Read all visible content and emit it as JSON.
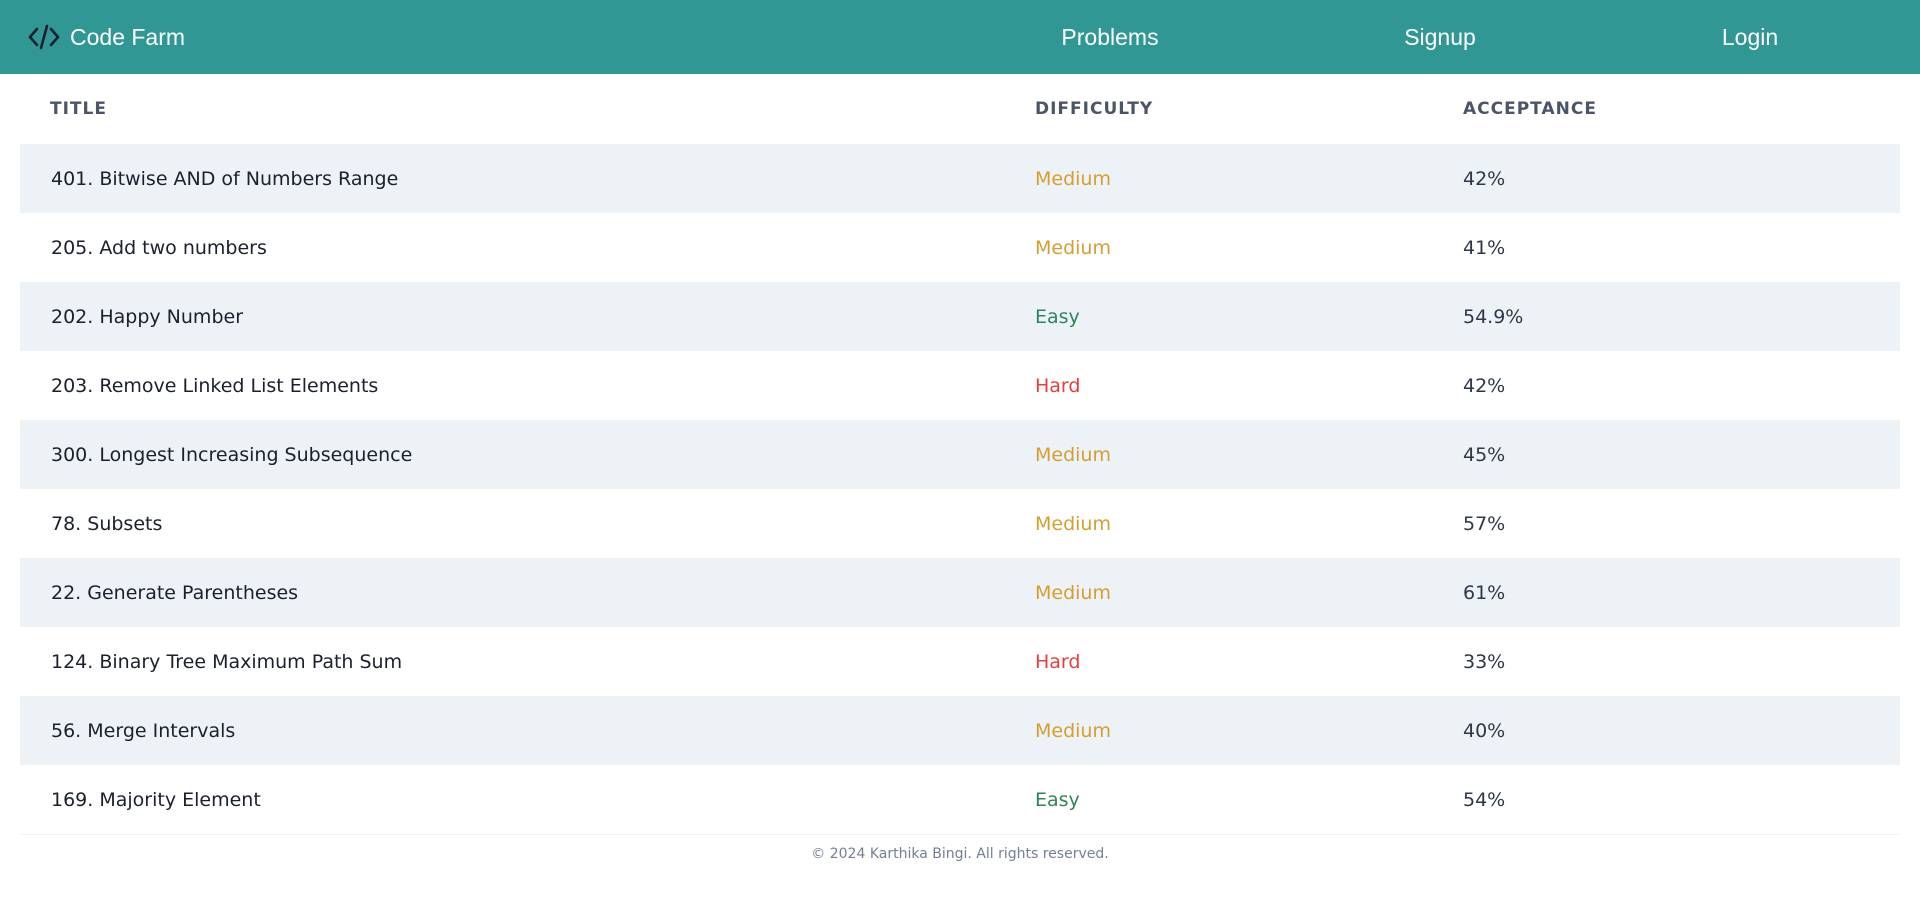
{
  "navbar": {
    "brand_icon": "code-icon",
    "brand_name": "Code Farm",
    "links": [
      "Problems",
      "Signup",
      "Login"
    ]
  },
  "table": {
    "headers": {
      "title": "Title",
      "difficulty": "Difficulty",
      "acceptance": "Acceptance"
    },
    "rows": [
      {
        "title": "401. Bitwise AND of Numbers Range",
        "difficulty": "Medium",
        "acceptance": "42%"
      },
      {
        "title": "205. Add two numbers",
        "difficulty": "Medium",
        "acceptance": "41%"
      },
      {
        "title": "202. Happy Number",
        "difficulty": "Easy",
        "acceptance": "54.9%"
      },
      {
        "title": "203. Remove Linked List Elements",
        "difficulty": "Hard",
        "acceptance": "42%"
      },
      {
        "title": "300. Longest Increasing Subsequence",
        "difficulty": "Medium",
        "acceptance": "45%"
      },
      {
        "title": "78. Subsets",
        "difficulty": "Medium",
        "acceptance": "57%"
      },
      {
        "title": "22. Generate Parentheses",
        "difficulty": "Medium",
        "acceptance": "61%"
      },
      {
        "title": "124. Binary Tree Maximum Path Sum",
        "difficulty": "Hard",
        "acceptance": "33%"
      },
      {
        "title": "56. Merge Intervals",
        "difficulty": "Medium",
        "acceptance": "40%"
      },
      {
        "title": "169. Majority Element",
        "difficulty": "Easy",
        "acceptance": "54%"
      }
    ]
  },
  "footer": {
    "text": "© 2024 Karthika Bingi. All rights reserved."
  },
  "colors": {
    "navbar": "#319795",
    "row_shade": "#edf2f7",
    "medium": "#d69e2e",
    "easy": "#2f855a",
    "hard": "#e53e3e"
  }
}
